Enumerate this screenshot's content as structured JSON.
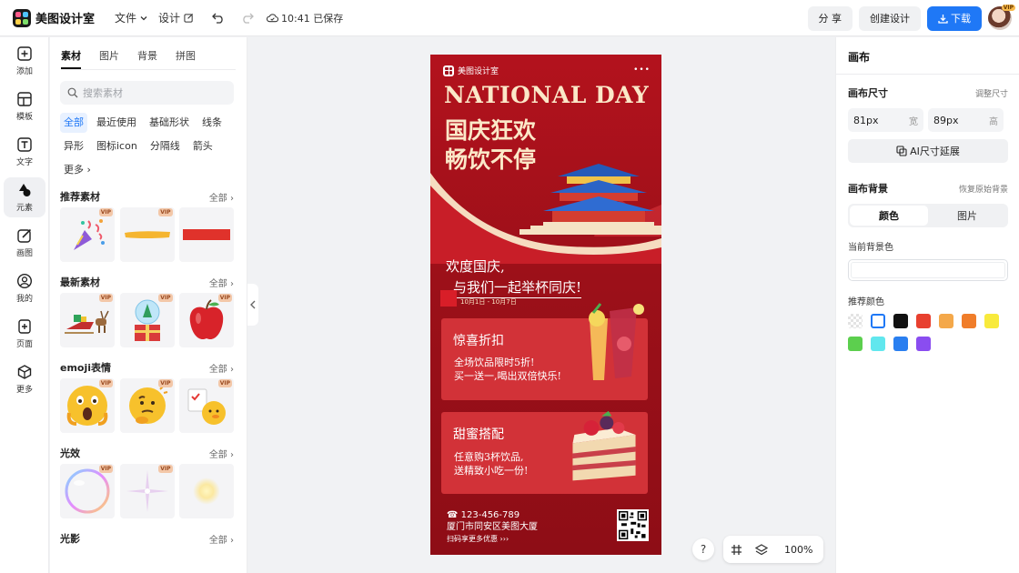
{
  "app": {
    "title": "美图设计室"
  },
  "topbar": {
    "file_menu": "文件",
    "design_menu": "设计",
    "save_status": "10:41 已保存",
    "share_label": "分 享",
    "create_label": "创建设计",
    "download_label": "下载",
    "vip_badge": "VIP"
  },
  "rail": {
    "items": [
      {
        "label": "添加",
        "icon": "plus-square-icon"
      },
      {
        "label": "模板",
        "icon": "template-icon"
      },
      {
        "label": "文字",
        "icon": "text-icon"
      },
      {
        "label": "元素",
        "icon": "shapes-icon"
      },
      {
        "label": "画图",
        "icon": "draw-icon"
      },
      {
        "label": "我的",
        "icon": "user-icon"
      },
      {
        "label": "页面",
        "icon": "page-add-icon"
      },
      {
        "label": "更多",
        "icon": "cube-icon"
      }
    ]
  },
  "assets": {
    "tabs": [
      "素材",
      "图片",
      "背景",
      "拼图"
    ],
    "search_placeholder": "搜索素材",
    "chips": [
      "全部",
      "最近使用",
      "基础形状",
      "线条",
      "异形",
      "图标icon",
      "分隔线",
      "箭头",
      "更多"
    ],
    "all_label": "全部",
    "vip": "VIP",
    "sections": [
      {
        "title": "推荐素材"
      },
      {
        "title": "最新素材"
      },
      {
        "title": "emoji表情"
      },
      {
        "title": "光效"
      },
      {
        "title": "光影"
      }
    ]
  },
  "poster": {
    "brand": "美图设计室",
    "dots": "•••",
    "headline_en": "NATIONAL DAY",
    "headline_cn_1": "国庆狂欢",
    "headline_cn_2": "畅饮不停",
    "message_1": "欢度国庆,",
    "message_2": "与我们一起举杯同庆!",
    "date": "10月1日 - 10月7日",
    "card1": {
      "title": "惊喜折扣",
      "line1": "全场饮品限时5折!",
      "line2": "买一送一,喝出双倍快乐!"
    },
    "card2": {
      "title": "甜蜜搭配",
      "line1": "任意购3杯饮品,",
      "line2": "送精致小吃一份!"
    },
    "phone": "123-456-789",
    "address": "厦门市同安区美图大厦",
    "scan": "扫码享更多优惠"
  },
  "canvas_tools": {
    "help": "?",
    "zoom": "100%"
  },
  "right_panel": {
    "title": "画布",
    "size_label": "画布尺寸",
    "resize_link": "调整尺寸",
    "width_value": "81px",
    "width_unit": "宽",
    "height_value": "89px",
    "height_unit": "高",
    "ai_button": "AI尺寸延展",
    "bg_label": "画布背景",
    "restore_link": "恢复原始背景",
    "seg_color": "颜色",
    "seg_image": "图片",
    "current_bg_label": "当前背景色",
    "recommended_label": "推荐颜色",
    "swatches": [
      "transparent",
      "#ffffff",
      "#111111",
      "#e8402f",
      "#f4a84a",
      "#f07d2a",
      "#f8ea3c",
      "#5ccf4e",
      "#61e7ee",
      "#2a7ff0",
      "#8a4df0"
    ]
  },
  "colors": {
    "accent": "#1f78f6",
    "poster_red": "#a3121d",
    "poster_cream": "#fbe8c8"
  }
}
